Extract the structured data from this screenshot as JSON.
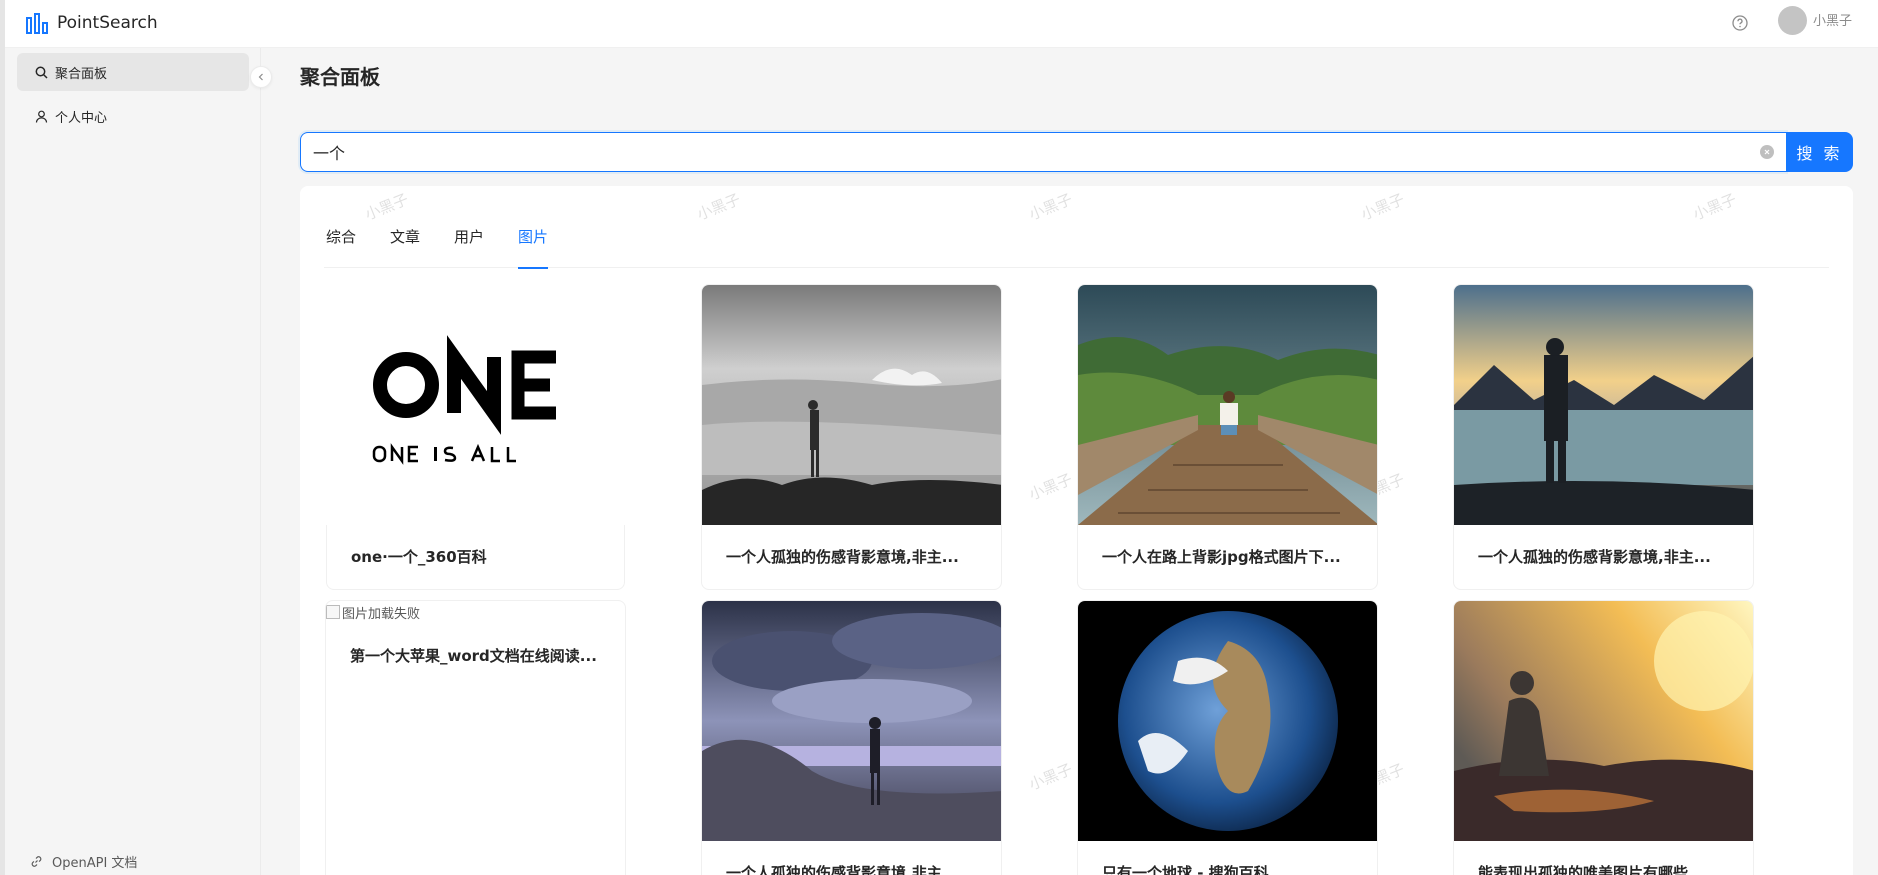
{
  "app": {
    "title": "PointSearch",
    "brand_color": "#1677ff"
  },
  "header": {
    "username": "小黑子",
    "help_icon": "question-circle-icon"
  },
  "sidebar": {
    "items": [
      {
        "label": "聚合面板",
        "icon": "search-icon",
        "active": true
      },
      {
        "label": "个人中心",
        "icon": "user-icon",
        "active": false
      }
    ],
    "footer_link": {
      "label": "OpenAPI 文档",
      "icon": "link-icon"
    }
  },
  "main": {
    "page_title": "聚合面板",
    "search": {
      "value": "一个",
      "button_label": "搜 索"
    },
    "tabs": [
      {
        "label": "综合",
        "active": false
      },
      {
        "label": "文章",
        "active": false
      },
      {
        "label": "用户",
        "active": false
      },
      {
        "label": "图片",
        "active": true
      }
    ],
    "watermark": "小黑子",
    "images": [
      {
        "caption": "one·一个_360百科",
        "image": "one-logo"
      },
      {
        "caption": "一个人孤独的伤感背影意境,非主...",
        "image": "person-on-rocks-sea-bw"
      },
      {
        "caption": "一个人在路上背影jpg格式图片下...",
        "image": "person-walking-on-bridge"
      },
      {
        "caption": "一个人孤独的伤感背影意境,非主...",
        "image": "person-by-lake-mountains"
      },
      {
        "caption": "第一个大苹果_word文档在线阅读...",
        "image": "broken",
        "alt": "图片加载失败"
      },
      {
        "caption": "一个人孤独的伤感背影意境,非主...",
        "image": "woman-on-beach-storm"
      },
      {
        "caption": "只有一个地球 - 搜狗百科",
        "image": "earth-globe"
      },
      {
        "caption": "能表现出孤独的唯美图片有哪些...",
        "image": "man-sitting-sunset"
      }
    ]
  }
}
